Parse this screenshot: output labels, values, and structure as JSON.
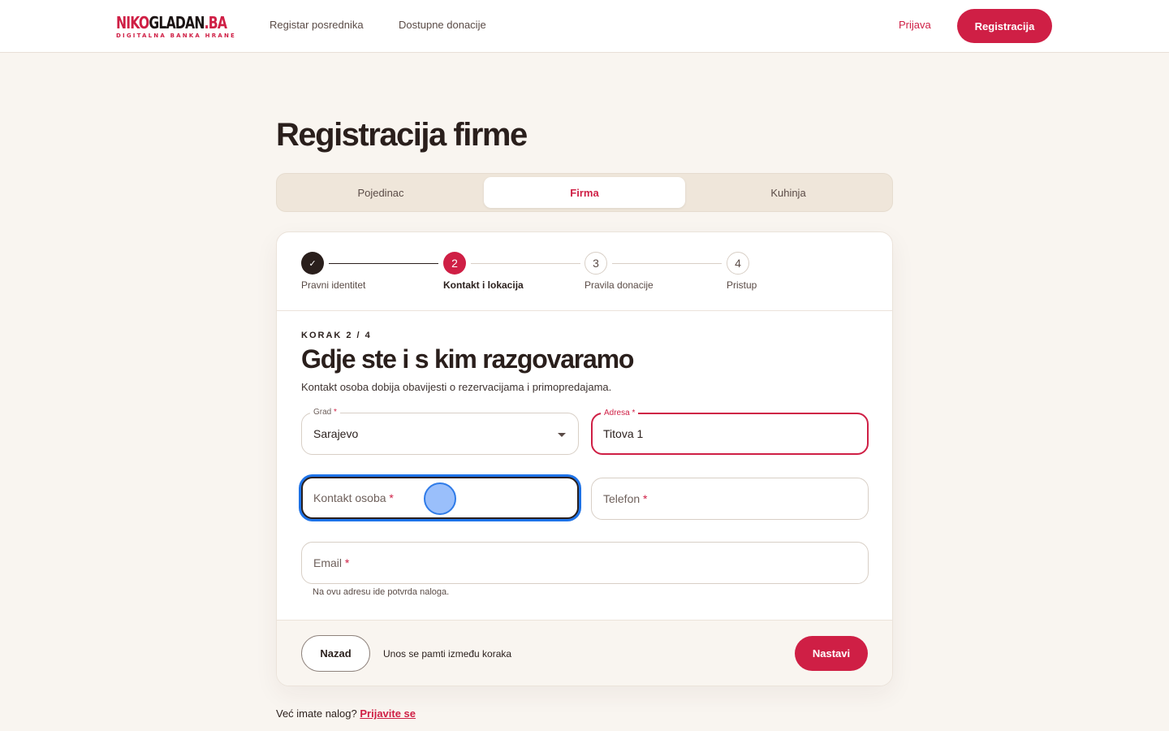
{
  "header": {
    "logo_red": "NIKO",
    "logo_dark": "GLADAN",
    "logo_tld": ".BA",
    "logo_tagline": "DIGITALNA BANKA HRANE",
    "nav": [
      "Registar posrednika",
      "Dostupne donacije"
    ],
    "login_label": "Prijava",
    "register_label": "Registracija"
  },
  "page_title": "Registracija firme",
  "tabs": [
    {
      "label": "Pojedinac",
      "active": false
    },
    {
      "label": "Firma",
      "active": true
    },
    {
      "label": "Kuhinja",
      "active": false
    }
  ],
  "stepper": {
    "steps": [
      {
        "number": "1",
        "label": "Pravni identitet",
        "state": "done"
      },
      {
        "number": "2",
        "label": "Kontakt i lokacija",
        "state": "current"
      },
      {
        "number": "3",
        "label": "Pravila donacije",
        "state": "todo"
      },
      {
        "number": "4",
        "label": "Pristup",
        "state": "todo"
      }
    ],
    "check_glyph": "✓"
  },
  "form": {
    "kicker": "KORAK 2 / 4",
    "title": "Gdje ste i s kim razgovaramo",
    "subtitle": "Kontakt osoba dobija obavijesti o rezervacijama i primopredajama.",
    "required_mark": "*",
    "city": {
      "label": "Grad",
      "value": "Sarajevo"
    },
    "address": {
      "label": "Adresa",
      "value": "Titova 1"
    },
    "contact_person": {
      "placeholder": "Kontakt osoba"
    },
    "phone": {
      "placeholder": "Telefon"
    },
    "email": {
      "placeholder": "Email",
      "hint": "Na ovu adresu ide potvrda naloga."
    }
  },
  "footer": {
    "back_label": "Nazad",
    "save_note": "Unos se pamti između koraka",
    "next_label": "Nastavi"
  },
  "bottom": {
    "question": "Već imate nalog?",
    "link": "Prijavite se"
  },
  "colors": {
    "accent": "#cf1f45",
    "dark": "#2a1f1c",
    "background": "#f9f5f0",
    "focus_ring": "#1e73e8"
  }
}
